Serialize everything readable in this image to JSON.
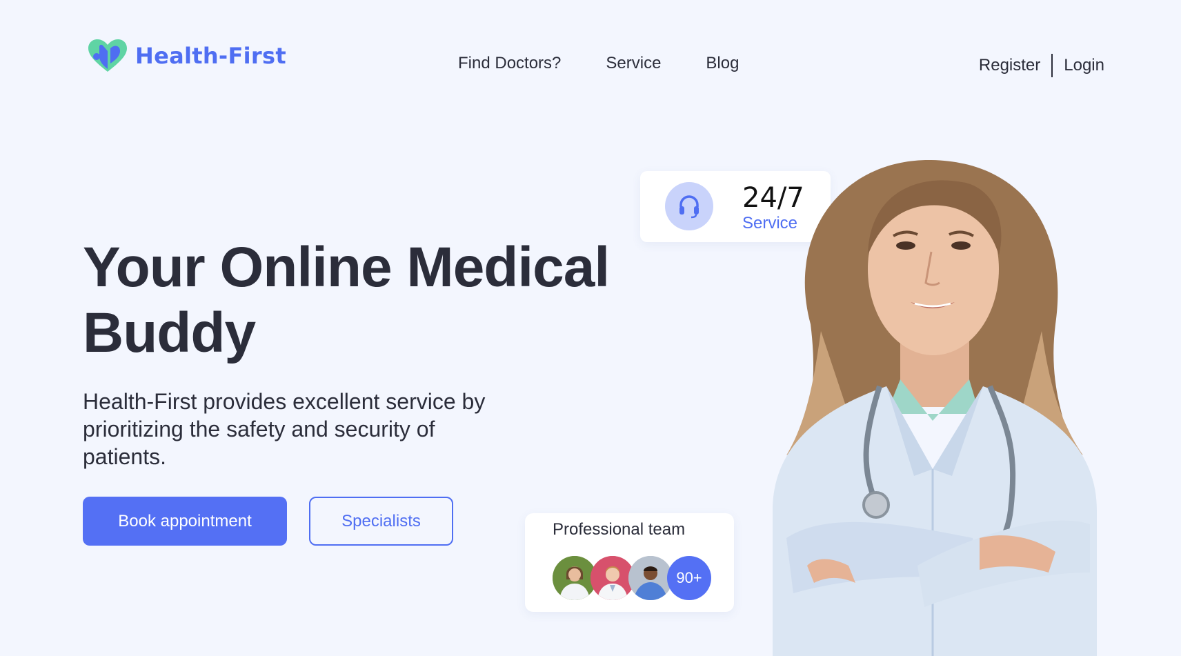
{
  "brand": {
    "name": "Health-First",
    "primary": "#5470f4",
    "accent": "#4f6ef2",
    "logo_green": "#5fd4a4"
  },
  "nav": {
    "items": [
      "Find Doctors?",
      "Service",
      "Blog"
    ]
  },
  "auth": {
    "register": "Register",
    "login": "Login"
  },
  "hero": {
    "headline_line1": "Your Online Medical",
    "headline_line2": "Buddy",
    "description": "Health-First provides excellent service by prioritizing the safety and security of patients.",
    "primary_button": "Book appointment",
    "secondary_button": "Specialists"
  },
  "service_card": {
    "icon": "headset-icon",
    "value": "24/7",
    "label": "Service"
  },
  "team_card": {
    "title": "Professional team",
    "count": "90+"
  }
}
